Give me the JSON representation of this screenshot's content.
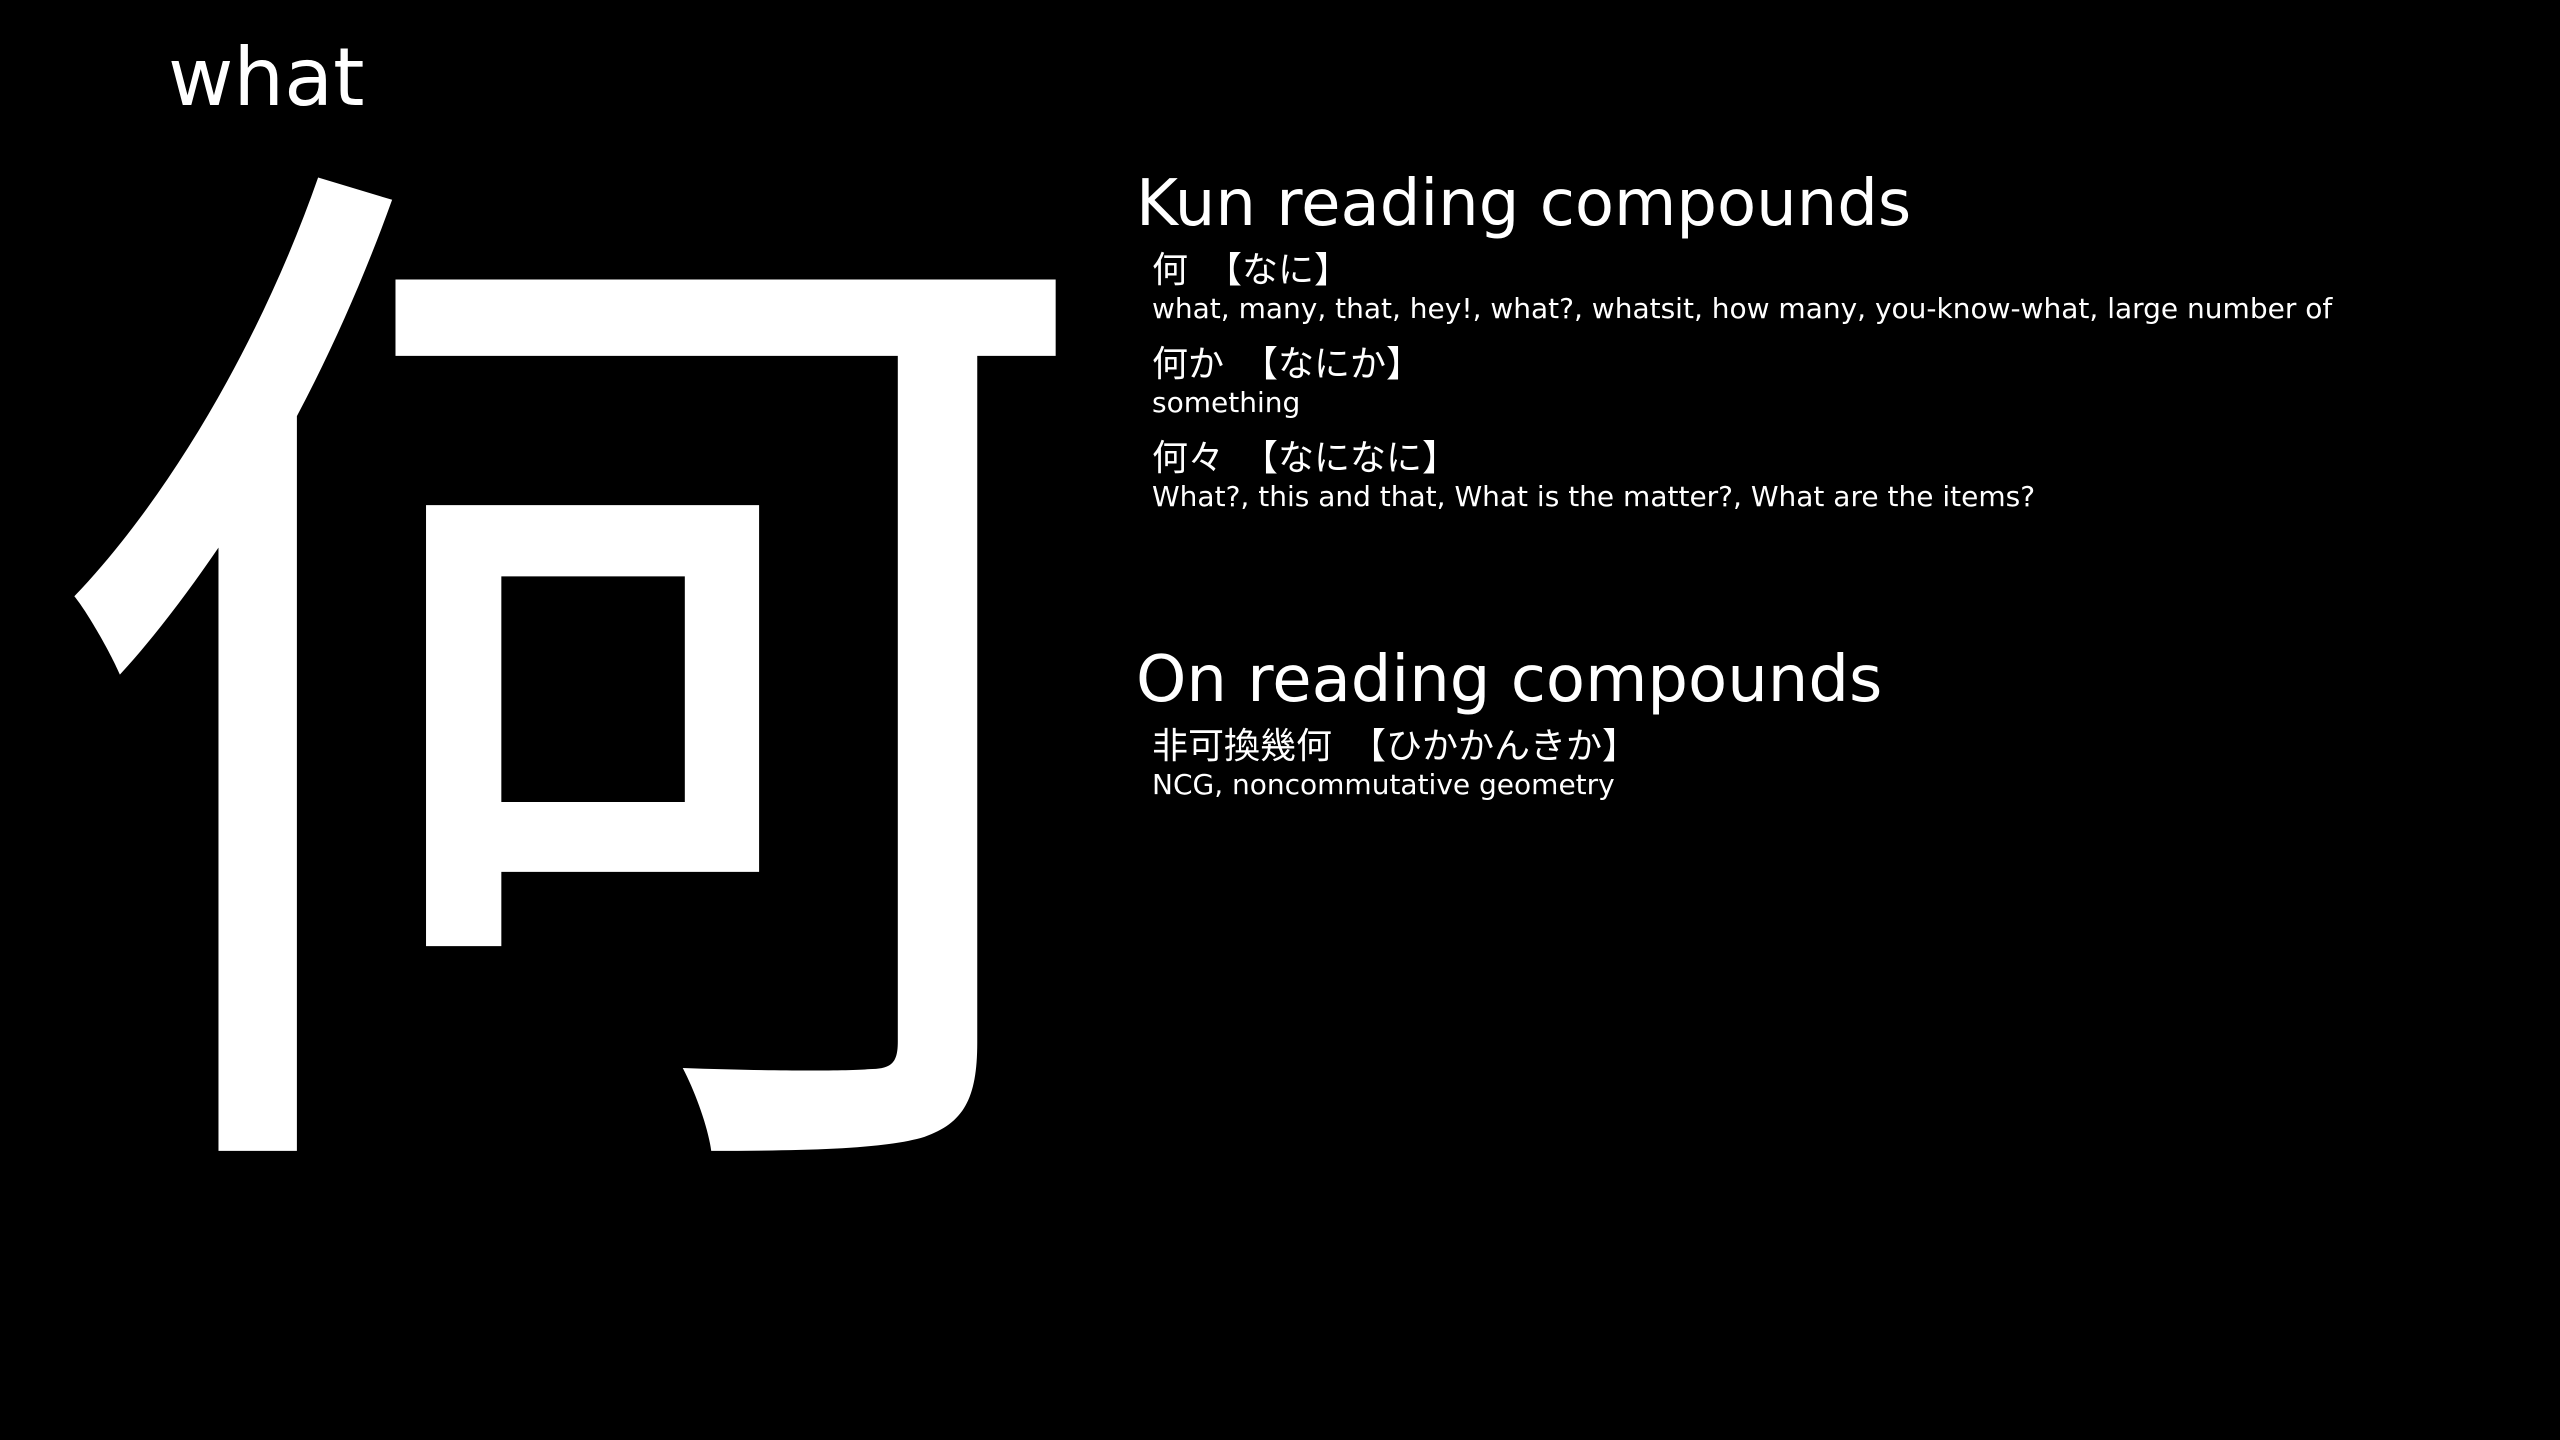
{
  "kanji": {
    "character": "何",
    "meaning": "what"
  },
  "kun_section": {
    "title": "Kun reading compounds",
    "compounds": [
      {
        "word": "何",
        "reading": "【なに】",
        "gloss": "what, many, that, hey!, what?, whatsit, how many, you-know-what, large number of"
      },
      {
        "word": "何か",
        "reading": "【なにか】",
        "gloss": "something"
      },
      {
        "word": "何々",
        "reading": "【なになに】",
        "gloss": "What?, this and that, What is the matter?, What are the items?"
      }
    ]
  },
  "on_section": {
    "title": "On reading compounds",
    "compounds": [
      {
        "word": "非可換幾何",
        "reading": "【ひかかんきか】",
        "gloss": "NCG, noncommutative geometry"
      }
    ]
  },
  "colors": {
    "background": "#000000",
    "foreground": "#ffffff"
  }
}
